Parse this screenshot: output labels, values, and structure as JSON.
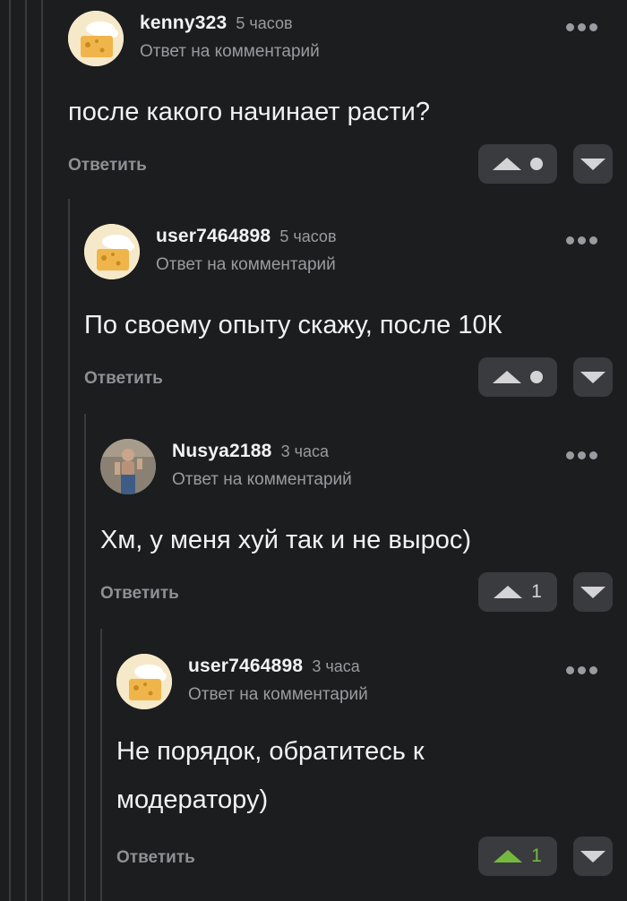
{
  "comments": [
    {
      "username": "kenny323",
      "time": "5 часов",
      "reply_to": "Ответ на комментарий",
      "text": [
        "после какого начинает расти?"
      ],
      "reply": "Ответить",
      "rating": "",
      "avatar": "cheese-avatar"
    },
    {
      "username": "user7464898",
      "time": "5 часов",
      "reply_to": "Ответ на комментарий",
      "text": [
        "По своему опыту скажу, после 10К"
      ],
      "reply": "Ответить",
      "rating": "",
      "avatar": "cheese-avatar"
    },
    {
      "username": "Nusya2188",
      "time": "3 часа",
      "reply_to": "Ответ на комментарий",
      "text": [
        "Хм, у меня хуй так и не вырос)"
      ],
      "reply": "Ответить",
      "rating": "1",
      "avatar": "photo-avatar"
    },
    {
      "username": "user7464898",
      "time": "3 часа",
      "reply_to": "Ответ на комментарий",
      "text": [
        "Не порядок, обратитесь к",
        "модератору)"
      ],
      "reply": "Ответить",
      "rating": "1",
      "rating_color": "#74b93e",
      "avatar": "cheese-avatar"
    }
  ],
  "colors": {
    "background": "#1c1d1f",
    "button_bg": "#3a3b3f",
    "upvoted": "#74b93e",
    "muted": "#9a9ba0"
  }
}
